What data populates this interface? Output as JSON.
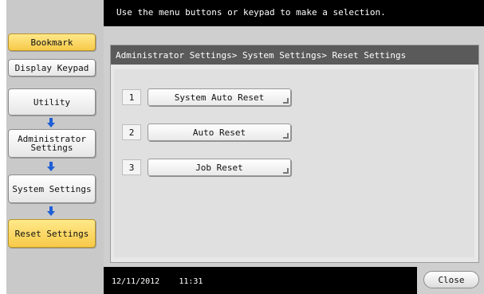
{
  "top_message": "Use the menu buttons or keypad to make a selection.",
  "sidebar": {
    "bookmark_label": "Bookmark",
    "display_keypad_label": "Display Keypad",
    "utility_label": "Utility",
    "administrator_settings_line1": "Administrator",
    "administrator_settings_line2": "Settings",
    "system_settings_label": "System Settings",
    "reset_settings_label": "Reset Settings"
  },
  "breadcrumb": "Administrator Settings> System Settings> Reset Settings",
  "options": [
    {
      "number": "1",
      "label": "System Auto Reset"
    },
    {
      "number": "2",
      "label": "Auto Reset"
    },
    {
      "number": "3",
      "label": "Job Reset"
    }
  ],
  "footer": {
    "date": "12/11/2012",
    "time": "11:31",
    "close_label": "Close"
  },
  "colors": {
    "highlight": "#f7c948",
    "arrow": "#1f5fd6",
    "topbar": "#000000",
    "panel_header": "#5a5a5a"
  },
  "icons": [
    "down-arrow-icon"
  ]
}
